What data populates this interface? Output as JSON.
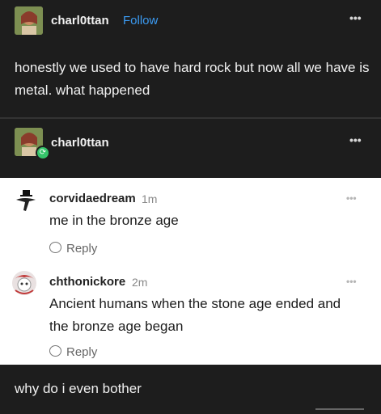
{
  "post": {
    "username": "charl0ttan",
    "follow_label": "Follow",
    "more_icon": "more-dots-icon",
    "text": "honestly we used to have hard rock but now all we have is metal. what happened"
  },
  "reblog": {
    "username": "charl0ttan",
    "more_icon": "more-dots-icon",
    "badge_icon": "reblog-icon"
  },
  "comments": [
    {
      "username": "corvidaedream",
      "time": "1m",
      "text": "me in the bronze age",
      "reply_label": "Reply"
    },
    {
      "username": "chthonickore",
      "time": "2m",
      "text": "Ancient humans when the stone age ended and the bronze age began",
      "reply_label": "Reply"
    }
  ],
  "footer": {
    "text": "why do i even bother"
  },
  "colors": {
    "background_dark": "#1d1d1d",
    "comment_panel": "#ffffff",
    "follow_link": "#3b9af1",
    "reblog_badge": "#35c46a"
  }
}
